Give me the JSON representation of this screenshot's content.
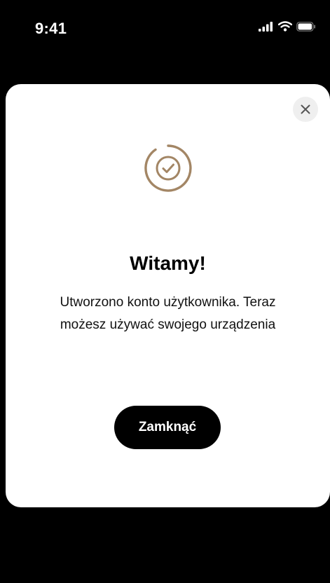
{
  "status_bar": {
    "time": "9:41",
    "icons": [
      "signal-icon",
      "wifi-icon",
      "battery-icon"
    ]
  },
  "dialog": {
    "icon": "check-circle-icon",
    "title": "Witamy!",
    "message": "Utworzono konto użytkownika. Teraz możesz używać swojego urządzenia",
    "primary_button_label": "Zamknąć",
    "close_icon": "close-icon"
  },
  "colors": {
    "background": "#000000",
    "modal": "#ffffff",
    "accent": "#a38665",
    "close_bg": "#efefef",
    "button": "#000000",
    "button_text": "#ffffff"
  }
}
